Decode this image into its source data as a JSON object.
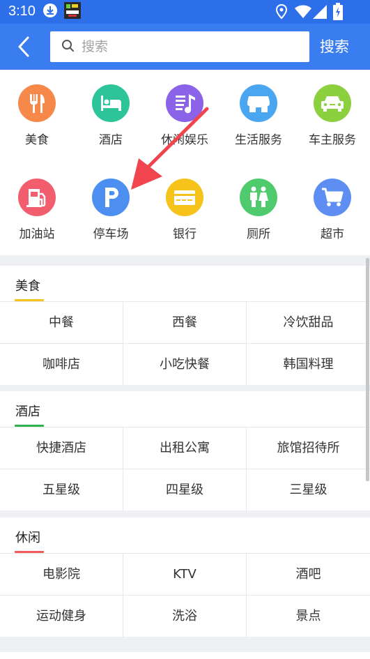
{
  "status_bar": {
    "time": "3:10"
  },
  "search": {
    "placeholder": "搜索",
    "button": "搜索"
  },
  "categories": [
    {
      "label": "美食",
      "icon": "fork-knife-icon",
      "color": "#f6884a"
    },
    {
      "label": "酒店",
      "icon": "bed-icon",
      "color": "#2ec49a"
    },
    {
      "label": "休闲娱乐",
      "icon": "music-note-icon",
      "color": "#8a63e8"
    },
    {
      "label": "生活服务",
      "icon": "shop-icon",
      "color": "#4aa6f0"
    },
    {
      "label": "车主服务",
      "icon": "car-icon",
      "color": "#8ccf3f"
    },
    {
      "label": "加油站",
      "icon": "fuel-pump-icon",
      "color": "#f25e6e"
    },
    {
      "label": "停车场",
      "icon": "parking-icon",
      "color": "#4c8ff0"
    },
    {
      "label": "银行",
      "icon": "bank-card-icon",
      "color": "#f5c31c"
    },
    {
      "label": "厕所",
      "icon": "restroom-icon",
      "color": "#4fcb6e"
    },
    {
      "label": "超市",
      "icon": "shopping-cart-icon",
      "color": "#5f8ef2"
    }
  ],
  "sections": [
    {
      "title": "美食",
      "accent": "#f5c31c",
      "items": [
        "中餐",
        "西餐",
        "冷饮甜品",
        "咖啡店",
        "小吃快餐",
        "韩国料理"
      ]
    },
    {
      "title": "酒店",
      "accent": "#2db34a",
      "items": [
        "快捷酒店",
        "出租公寓",
        "旅馆招待所",
        "五星级",
        "四星级",
        "三星级"
      ]
    },
    {
      "title": "休闲",
      "accent": "#ef5a5a",
      "items": [
        "电影院",
        "KTV",
        "酒吧",
        "运动健身",
        "洗浴",
        "景点"
      ]
    }
  ],
  "colors": {
    "header": "#3a7df0",
    "status_bar": "#2d6fe9",
    "arrow": "#f0454e"
  }
}
